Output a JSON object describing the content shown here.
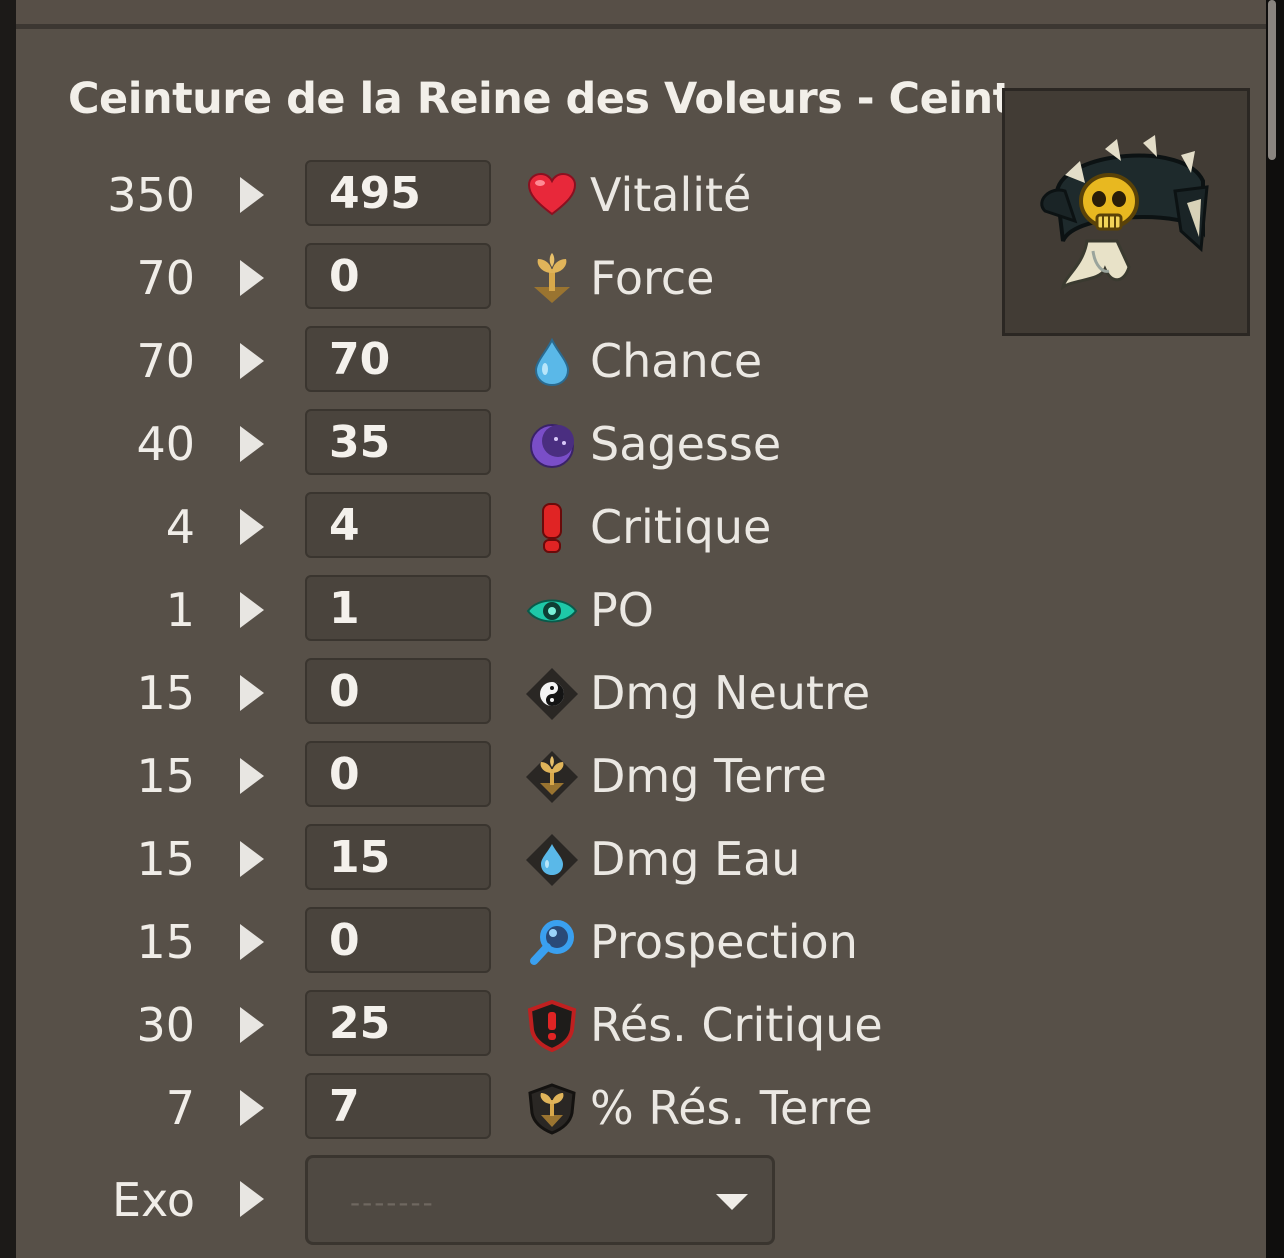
{
  "item": {
    "title": "Ceinture de la Reine des Voleurs - Ceinture",
    "image_icon": "belt-skull-icon"
  },
  "stats": [
    {
      "max": "350",
      "value": "495",
      "label": "Vitalité",
      "icon": "heart-icon"
    },
    {
      "max": "70",
      "value": "0",
      "label": "Force",
      "icon": "earth-sprout-icon"
    },
    {
      "max": "70",
      "value": "70",
      "label": "Chance",
      "icon": "water-drop-icon"
    },
    {
      "max": "40",
      "value": "35",
      "label": "Sagesse",
      "icon": "moon-icon"
    },
    {
      "max": "4",
      "value": "4",
      "label": "Critique",
      "icon": "exclamation-icon"
    },
    {
      "max": "1",
      "value": "1",
      "label": "PO",
      "icon": "eye-icon"
    },
    {
      "max": "15",
      "value": "0",
      "label": "Dmg Neutre",
      "icon": "yin-yang-diamond-icon"
    },
    {
      "max": "15",
      "value": "0",
      "label": "Dmg Terre",
      "icon": "earth-diamond-icon"
    },
    {
      "max": "15",
      "value": "15",
      "label": "Dmg Eau",
      "icon": "water-diamond-icon"
    },
    {
      "max": "15",
      "value": "0",
      "label": "Prospection",
      "icon": "magnifier-icon"
    },
    {
      "max": "30",
      "value": "25",
      "label": "Rés. Critique",
      "icon": "crit-shield-icon"
    },
    {
      "max": "7",
      "value": "7",
      "label": "% Rés. Terre",
      "icon": "earth-shield-icon"
    }
  ],
  "exo": {
    "label": "Exo",
    "placeholder": "-------",
    "caret_icon": "caret-down-icon"
  },
  "colors": {
    "background": "#575048",
    "input_bg": "#4a443d",
    "text": "#f0ede8"
  }
}
